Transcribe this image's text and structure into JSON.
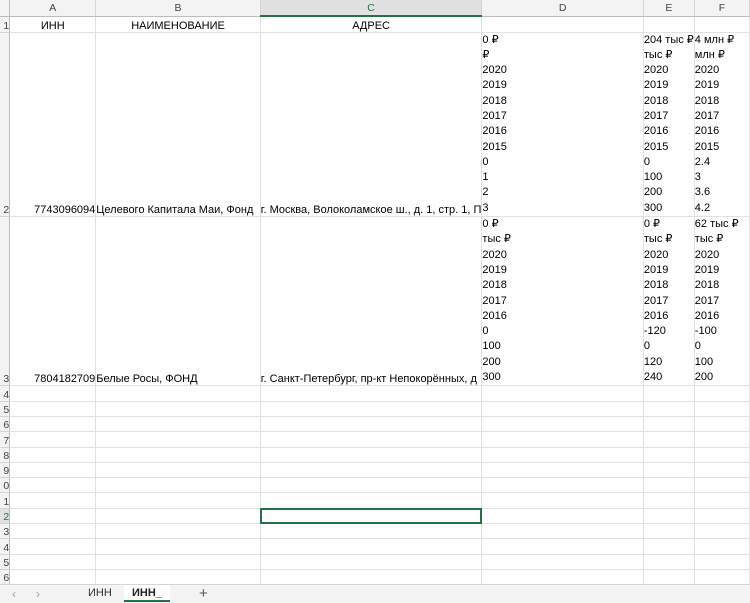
{
  "columns": [
    "A",
    "B",
    "C",
    "D",
    "E",
    "F"
  ],
  "row_numbers": [
    "1",
    "2",
    "3",
    "4",
    "5",
    "6",
    "7",
    "8",
    "9",
    "0",
    "1",
    "2",
    "3",
    "4",
    "5",
    "6"
  ],
  "header_row": {
    "A": "ИНН",
    "B": "НАИМЕНОВАНИЕ",
    "C": "АДРЕС"
  },
  "rows": [
    {
      "inn": "7743096094",
      "name": "Целевого Капитала Маи, Фонд",
      "address": "г. Москва, Волоколамское ш., д. 1, стр. 1, П",
      "D": [
        "0 ₽",
        "₽",
        "2020",
        "2019",
        "2018",
        "2017",
        "2016",
        "2015",
        "0",
        "1",
        "2",
        "3"
      ],
      "E": [
        "204 тыс ₽",
        "тыс ₽",
        "2020",
        "2019",
        "2018",
        "2017",
        "2016",
        "2015",
        "0",
        "100",
        "200",
        "300"
      ],
      "F": [
        "4 млн ₽",
        "млн ₽",
        "2020",
        "2019",
        "2018",
        "2017",
        "2016",
        "2015",
        "2.4",
        "3",
        "3.6",
        "4.2"
      ]
    },
    {
      "inn": "7804182709",
      "name": "Белые Росы, ФОНД",
      "address": "г. Санкт-Петербург, пр-кт Непокорённых, д",
      "D": [
        "0 ₽",
        "тыс ₽",
        "2020",
        "2019",
        "2018",
        "2017",
        "2016",
        "0",
        "100",
        "200",
        "300"
      ],
      "E": [
        "0 ₽",
        "тыс ₽",
        "2020",
        "2019",
        "2018",
        "2017",
        "2016",
        "-120",
        "0",
        "120",
        "240"
      ],
      "F": [
        "62 тыс ₽",
        "тыс ₽",
        "2020",
        "2019",
        "2018",
        "2017",
        "2016",
        "-100",
        "0",
        "100",
        "200"
      ]
    }
  ],
  "sheet_tabs": [
    {
      "label": "ИНН",
      "active": false
    },
    {
      "label": "ИНН_",
      "active": true
    }
  ],
  "add_sheet": "+",
  "nav": {
    "prev": "‹",
    "next": "›"
  }
}
